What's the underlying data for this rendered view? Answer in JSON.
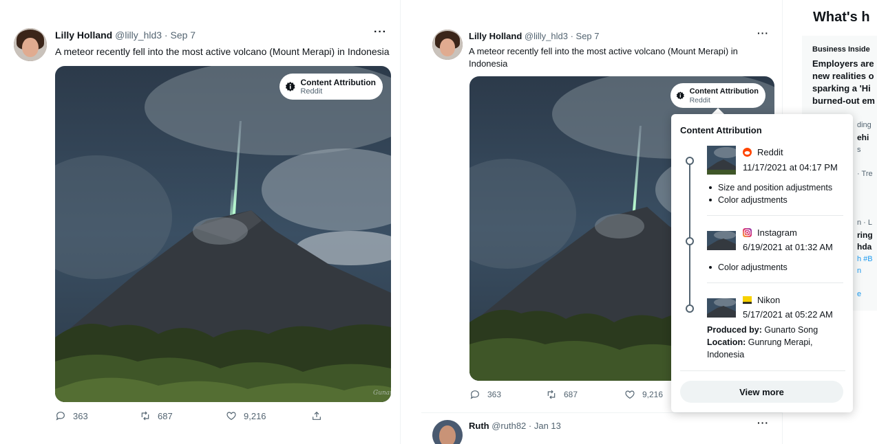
{
  "tweet_left": {
    "name": "Lilly Holland",
    "meta": "@lilly_hld3 · Sep 7",
    "text": "A meteor recently fell into the most active volcano (Mount Merapi) in Indonesia",
    "attribution_title": "Content Attribution",
    "attribution_source": "Reddit",
    "watermark": "Gunarto",
    "replies": "363",
    "retweets": "687",
    "likes": "9,216"
  },
  "tweet_right": {
    "name": "Lilly Holland",
    "meta": "@lilly_hld3 · Sep 7",
    "text_line1": "A meteor recently fell into the most active volcano (Mount Merapi) in",
    "text_line2": "Indonesia",
    "attribution_title": "Content Attribution",
    "attribution_source": "Reddit",
    "replies": "363",
    "retweets": "687",
    "likes": "9,216"
  },
  "next_tweet": {
    "name": "Ruth",
    "meta": "@ruth82 · Jan 13"
  },
  "popover": {
    "title": "Content Attribution",
    "entries": [
      {
        "source": "Reddit",
        "icon": "reddit-icon",
        "date": "11/17/2021 at 04:17 PM",
        "edits": [
          "Size and position adjustments",
          "Color adjustments"
        ]
      },
      {
        "source": "Instagram",
        "icon": "instagram-icon",
        "date": "6/19/2021 at 01:32 AM",
        "edits": [
          "Color adjustments"
        ]
      },
      {
        "source": "Nikon",
        "icon": "nikon-icon",
        "date": "5/17/2021 at 05:22 AM",
        "produced_label": "Produced by:",
        "produced_value": "Gunarto Song",
        "location_label": "Location:",
        "location_value": "Gunrung Merapi, Indonesia"
      }
    ],
    "view_more": "View more"
  },
  "trends": {
    "top_fragment": "What's h",
    "source": "Business Inside",
    "headline_lines": [
      "Employers are",
      "new realities o",
      "sparking a 'Hi",
      "burned-out em"
    ],
    "fragments": [
      "ding",
      "ehi",
      "s",
      "· Tre",
      "n · L",
      "ring",
      "hda",
      "h #B",
      "n",
      "e"
    ]
  },
  "colors": {
    "text": "#0f1419",
    "muted": "#536471",
    "reddit": "#ff4500",
    "nikon": "#f7d100"
  }
}
